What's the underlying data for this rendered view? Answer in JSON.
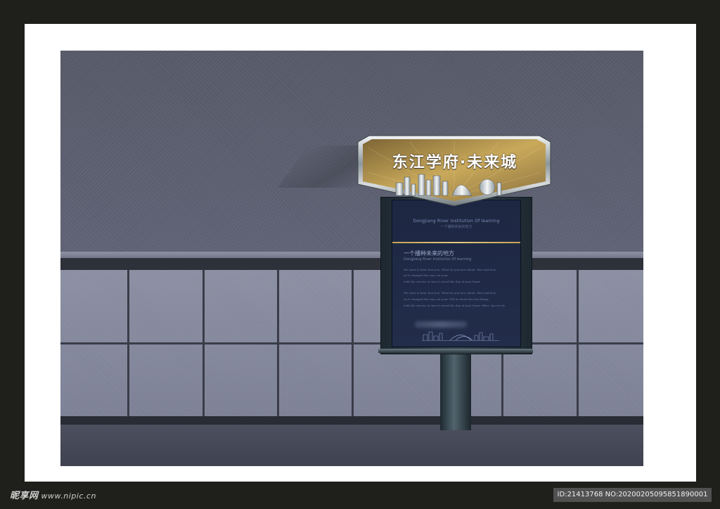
{
  "sign": {
    "brand_text": "东江学府·未来城",
    "caption_en": "DongJiang River Institution Of learning",
    "caption_cn": "一个播种未来的地方",
    "heading_cn": "一个播种未来的地方",
    "heading_en": "DongJiang River Institution Of learning",
    "body_lines": [
      "We want to hear how you. What do you love about. Mar and how",
      "an it changed the way out your",
      "with the service or how it saved the day at your home",
      "We want to hear how you. What do you love about. Mar and how",
      "an it changed the way out your. Tell us about the fun things",
      "with the service or how it saved the day at your home office. Am we do"
    ]
  },
  "watermark": {
    "logo_text": "昵享网",
    "site_text": "www.nipic.cn",
    "id_text": "ID:21413768 NO:20200205095851890001"
  },
  "colors": {
    "wall": "#5f6271",
    "tiles": "#8a8ea1",
    "panel": "#1f2946",
    "gold": "#c5a352",
    "frame": "#2c3a42"
  }
}
